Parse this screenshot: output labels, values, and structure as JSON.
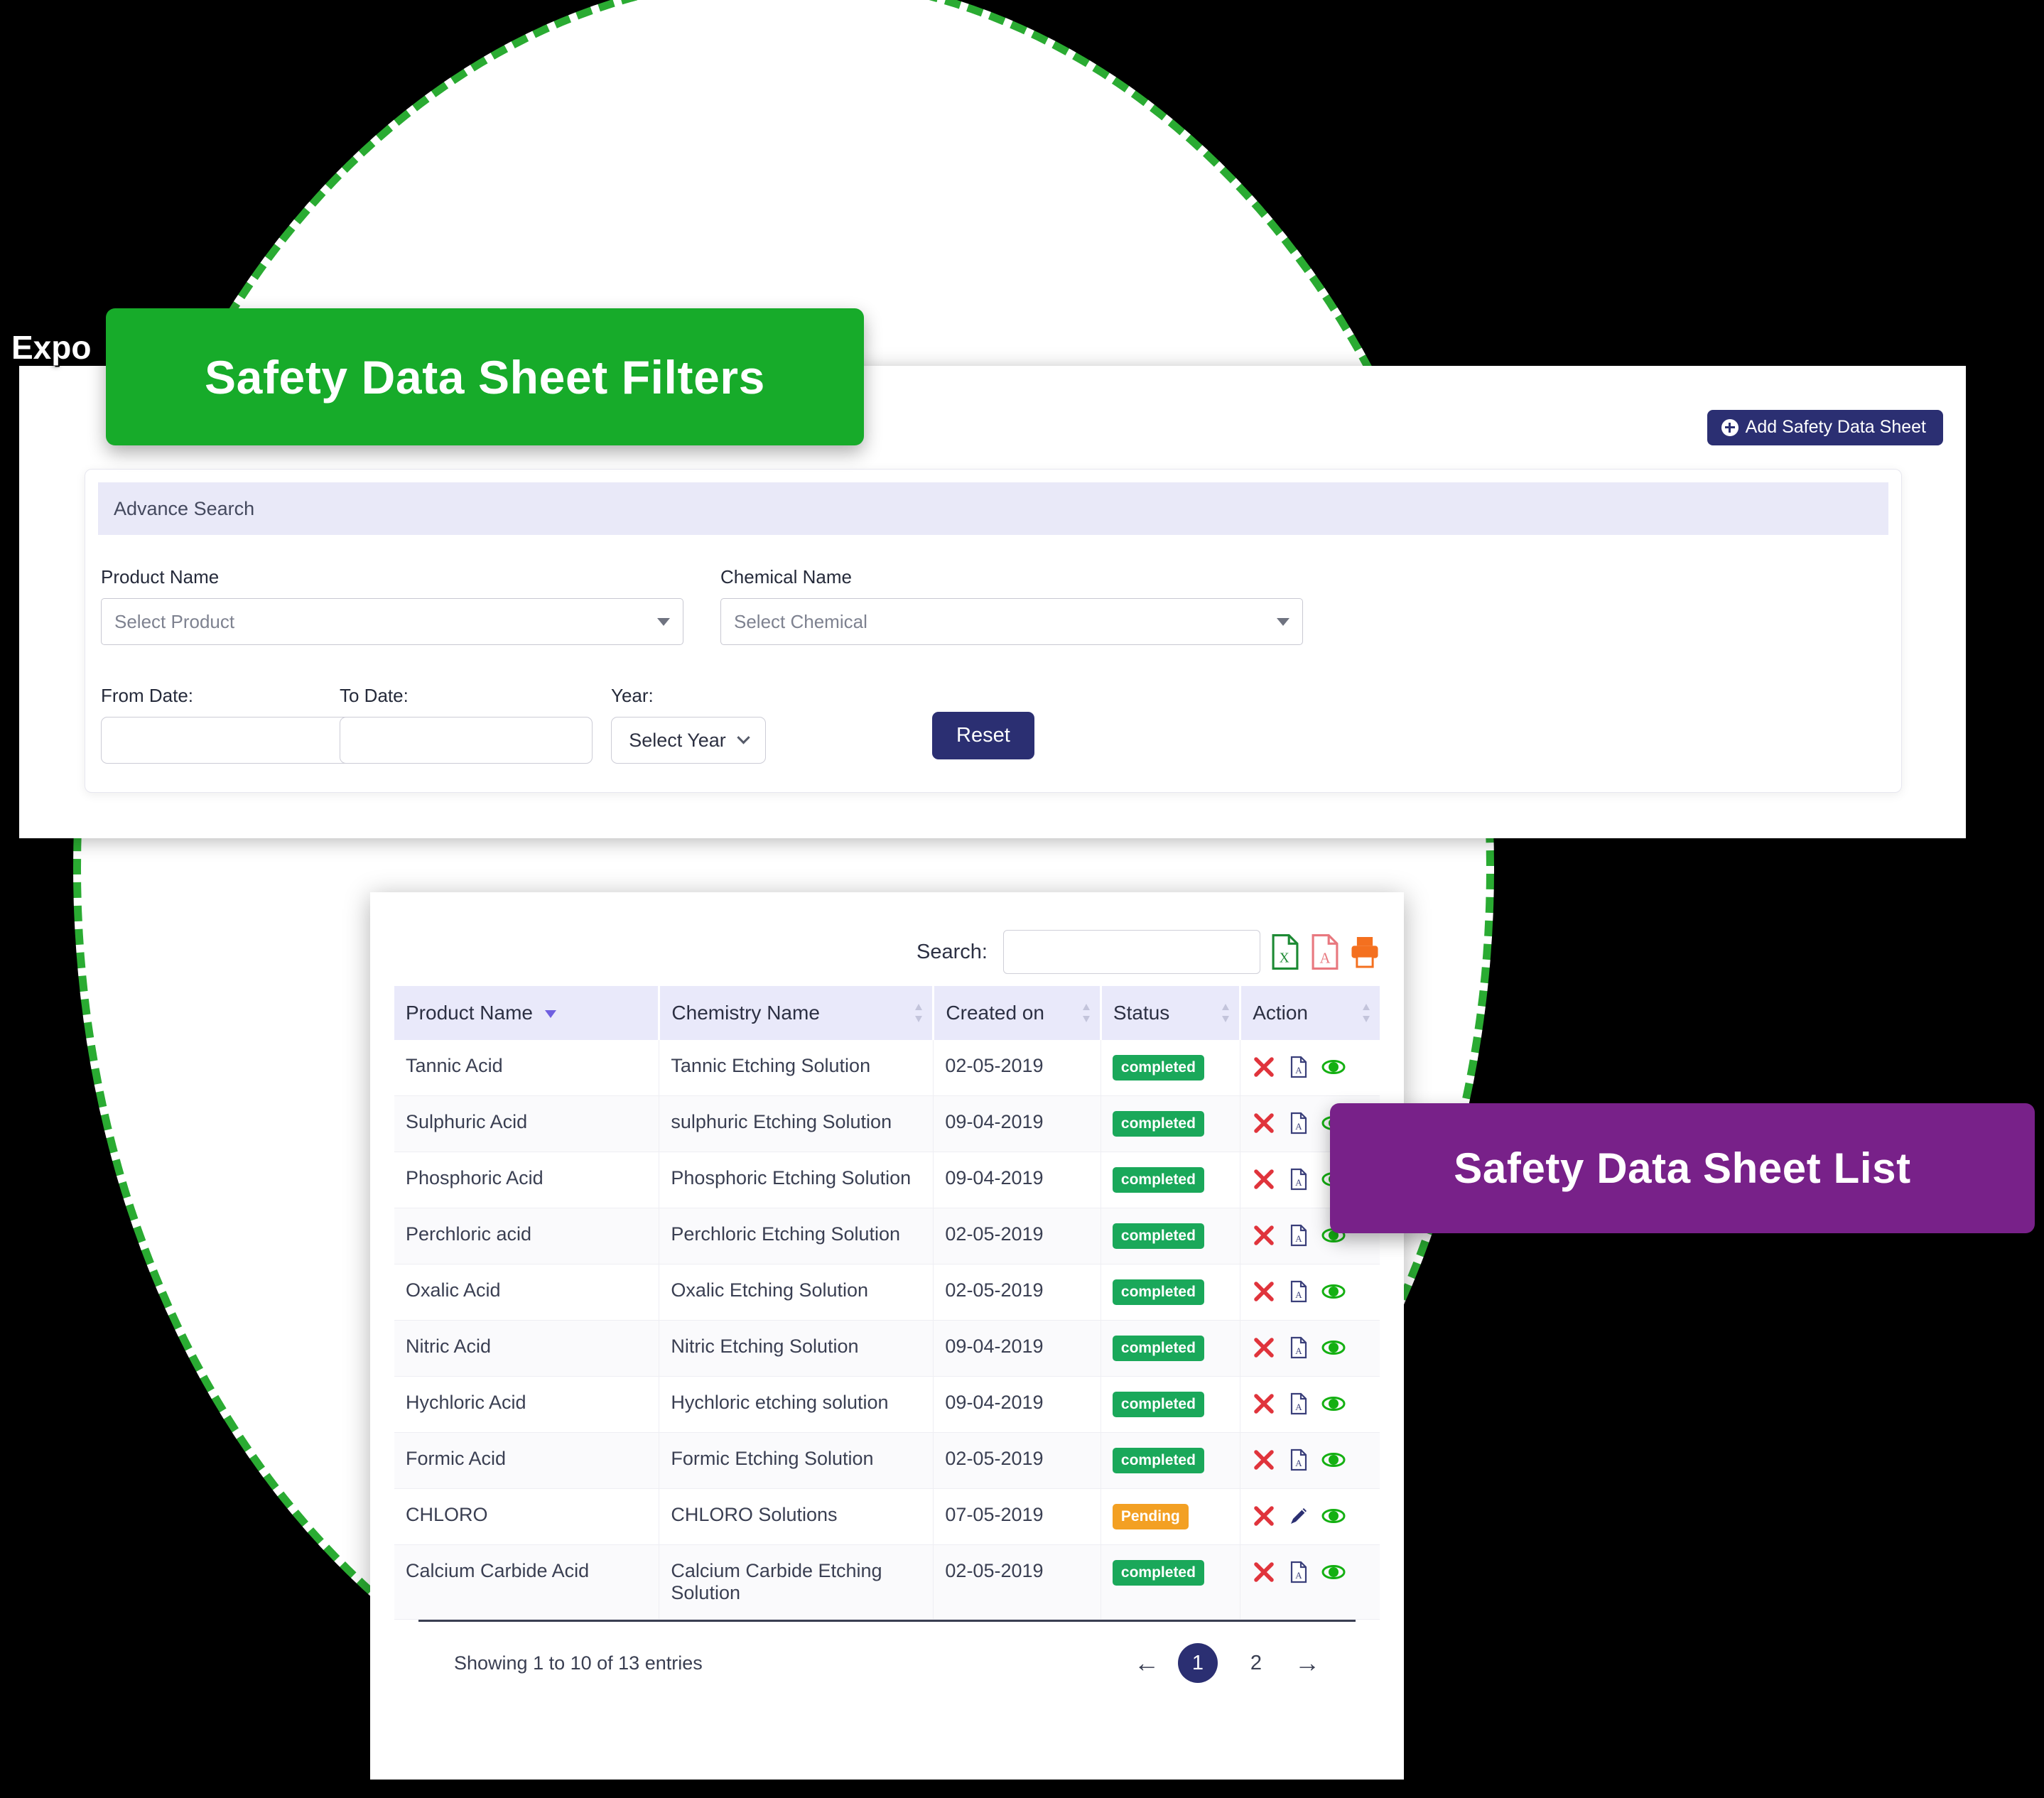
{
  "background": {
    "circle_border_color": "#2aab32",
    "page_bg": "#000000"
  },
  "badges": {
    "filters_ribbon": "Safety Data Sheet Filters",
    "list_ribbon": "Safety Data Sheet List",
    "filters_color": "#17ab2a",
    "list_color": "#782189"
  },
  "logo_text": "Expo",
  "filters": {
    "add_button": "Add Safety Data Sheet",
    "advance_search_title": "Advance Search",
    "product_name_label": "Product Name",
    "product_name_value": "Select Product",
    "chemical_name_label": "Chemical Name",
    "chemical_name_value": "Select Chemical",
    "from_date_label": "From Date:",
    "from_date_value": "",
    "to_date_label": "To Date:",
    "to_date_value": "",
    "year_label": "Year:",
    "year_value": "Select Year",
    "reset_button": "Reset"
  },
  "table": {
    "search_label": "Search:",
    "search_value": "",
    "search_placeholder": "",
    "export_icons": [
      "excel-export-icon",
      "pdf-export-icon",
      "print-icon"
    ],
    "columns": [
      "Product Name",
      "Chemistry Name",
      "Created on",
      "Status",
      "Action"
    ],
    "sorted_column": "Product Name",
    "rows": [
      {
        "product": "Tannic Acid",
        "chemistry": "Tannic Etching Solution",
        "created": "02-05-2019",
        "status": "completed",
        "status_kind": "completed",
        "actions": [
          "delete-icon",
          "pdf-icon",
          "view-icon"
        ]
      },
      {
        "product": "Sulphuric Acid",
        "chemistry": "sulphuric Etching Solution",
        "created": "09-04-2019",
        "status": "completed",
        "status_kind": "completed",
        "actions": [
          "delete-icon",
          "pdf-icon",
          "view-icon"
        ]
      },
      {
        "product": "Phosphoric Acid",
        "chemistry": "Phosphoric Etching Solution",
        "created": "09-04-2019",
        "status": "completed",
        "status_kind": "completed",
        "actions": [
          "delete-icon",
          "pdf-icon",
          "view-icon"
        ]
      },
      {
        "product": "Perchloric acid",
        "chemistry": "Perchloric Etching Solution",
        "created": "02-05-2019",
        "status": "completed",
        "status_kind": "completed",
        "actions": [
          "delete-icon",
          "pdf-icon",
          "view-icon"
        ]
      },
      {
        "product": "Oxalic Acid",
        "chemistry": "Oxalic Etching Solution",
        "created": "02-05-2019",
        "status": "completed",
        "status_kind": "completed",
        "actions": [
          "delete-icon",
          "pdf-icon",
          "view-icon"
        ]
      },
      {
        "product": "Nitric Acid",
        "chemistry": "Nitric Etching Solution",
        "created": "09-04-2019",
        "status": "completed",
        "status_kind": "completed",
        "actions": [
          "delete-icon",
          "pdf-icon",
          "view-icon"
        ]
      },
      {
        "product": "Hychloric Acid",
        "chemistry": "Hychloric etching solution",
        "created": "09-04-2019",
        "status": "completed",
        "status_kind": "completed",
        "actions": [
          "delete-icon",
          "pdf-icon",
          "view-icon"
        ]
      },
      {
        "product": "Formic Acid",
        "chemistry": "Formic Etching Solution",
        "created": "02-05-2019",
        "status": "completed",
        "status_kind": "completed",
        "actions": [
          "delete-icon",
          "pdf-icon",
          "view-icon"
        ]
      },
      {
        "product": "CHLORO",
        "chemistry": "CHLORO Solutions",
        "created": "07-05-2019",
        "status": "Pending",
        "status_kind": "pending",
        "actions": [
          "delete-icon",
          "edit-icon",
          "view-icon"
        ]
      },
      {
        "product": "Calcium Carbide Acid",
        "chemistry": "Calcium Carbide Etching Solution",
        "created": "02-05-2019",
        "status": "completed",
        "status_kind": "completed",
        "actions": [
          "delete-icon",
          "pdf-icon",
          "view-icon"
        ]
      }
    ],
    "showing_text": "Showing 1 to 10 of 13 entries",
    "pagination": {
      "prev": "←",
      "pages": [
        "1",
        "2"
      ],
      "active_page": "1",
      "next": "→"
    }
  }
}
